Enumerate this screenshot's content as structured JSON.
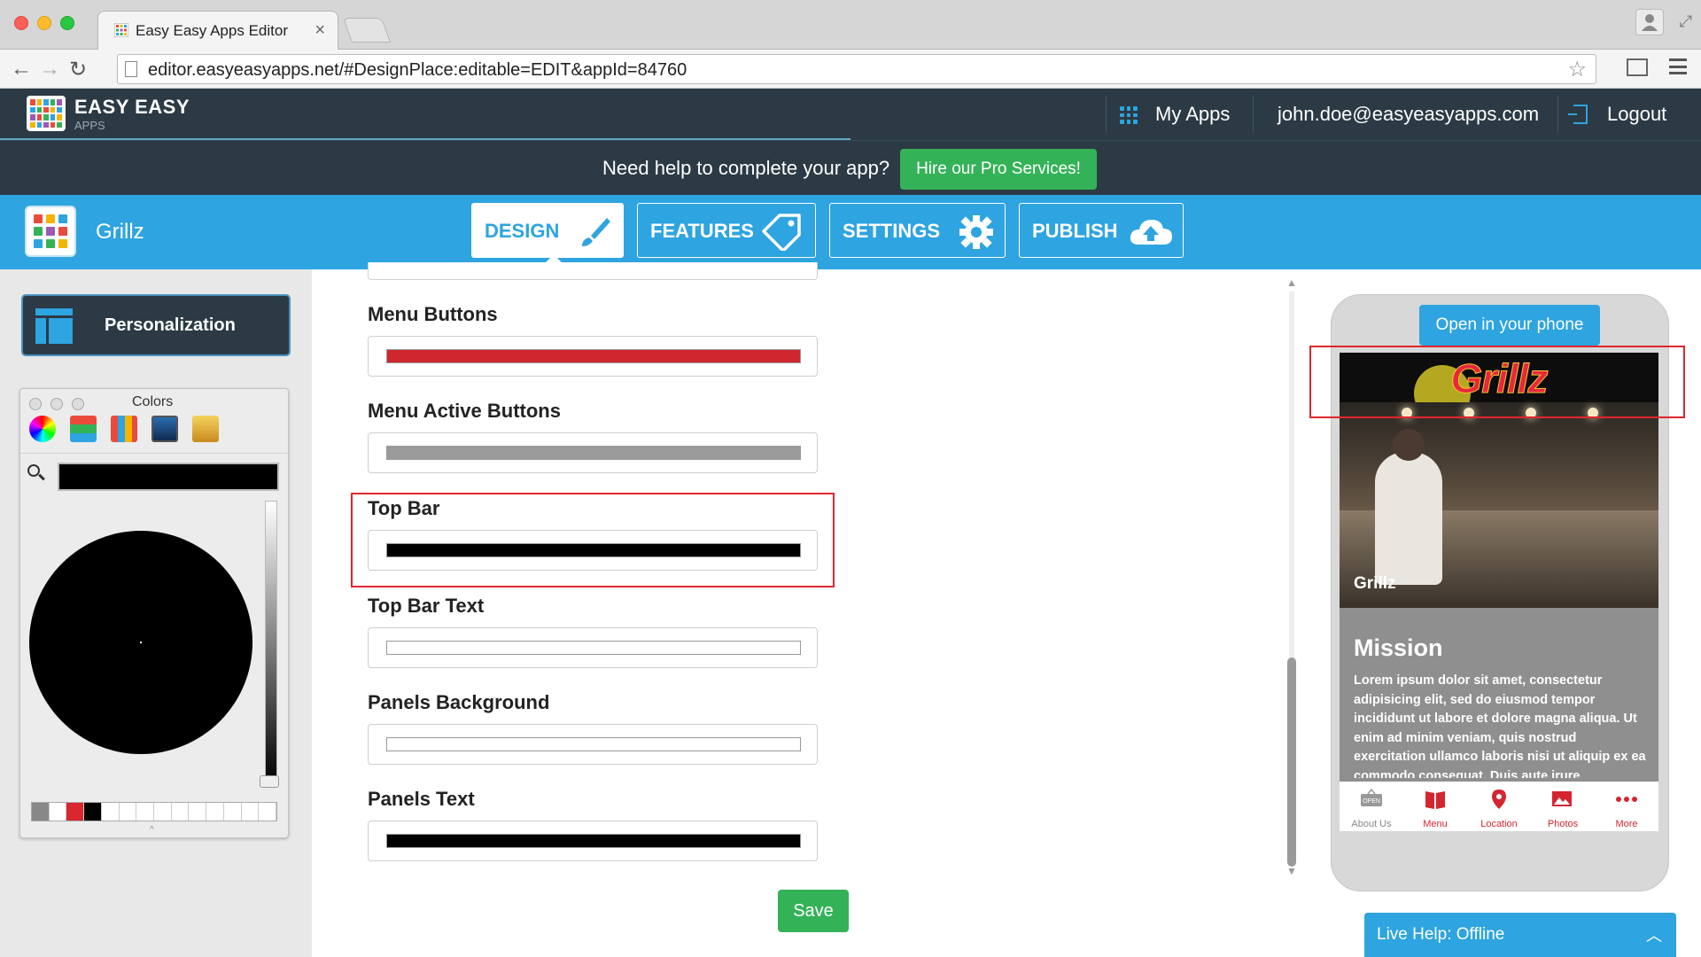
{
  "browser": {
    "tab_title": "Easy Easy Apps Editor",
    "tab_close": "×",
    "url": "editor.easyeasyapps.net/#DesignPlace:editable=EDIT&appId=84760"
  },
  "header": {
    "logo_line1": "EASY EASY",
    "logo_line2": "APPS",
    "my_apps": "My Apps",
    "user_email": "john.doe@easyeasyapps.com",
    "logout": "Logout"
  },
  "help_bar": {
    "text": "Need help to complete your app?",
    "button": "Hire our Pro Services!"
  },
  "nav": {
    "app_name": "Grillz",
    "tabs": [
      "DESIGN",
      "FEATURES",
      "SETTINGS",
      "PUBLISH"
    ],
    "active_tab": "DESIGN"
  },
  "sidebar": {
    "personalization": "Personalization",
    "colors_panel": {
      "title": "Colors",
      "palette": [
        "#888888",
        "#ffffff",
        "#d9262f",
        "#000000"
      ]
    }
  },
  "fields": [
    {
      "label": "Menu Buttons",
      "color": "#d0262f"
    },
    {
      "label": "Menu Active Buttons",
      "color": "#9b9b9b"
    },
    {
      "label": "Top Bar",
      "color": "#000000"
    },
    {
      "label": "Top Bar Text",
      "color": "#ffffff"
    },
    {
      "label": "Panels Background",
      "color": "#ffffff"
    },
    {
      "label": "Panels Text",
      "color": "#000000"
    }
  ],
  "save_button": "Save",
  "preview": {
    "open_button": "Open in your phone",
    "title": "Grillz",
    "hero_label": "Grillz",
    "panel_title": "Mission",
    "panel_text": "Lorem ipsum dolor sit amet, consectetur adipisicing elit, sed do eiusmod tempor incididunt ut labore et dolore magna aliqua. Ut enim ad minim veniam, quis nostrud exercitation ullamco laboris nisi ut aliquip ex ea commodo consequat. Duis aute irure",
    "tabbar": [
      "About Us",
      "Menu",
      "Location",
      "Photos",
      "More"
    ]
  },
  "live_help": "Live Help: Offline",
  "colors": {
    "brand_blue": "#2ea4e0",
    "header_dark": "#2b3a44",
    "green": "#34b258",
    "highlight_red": "#e0262c"
  }
}
